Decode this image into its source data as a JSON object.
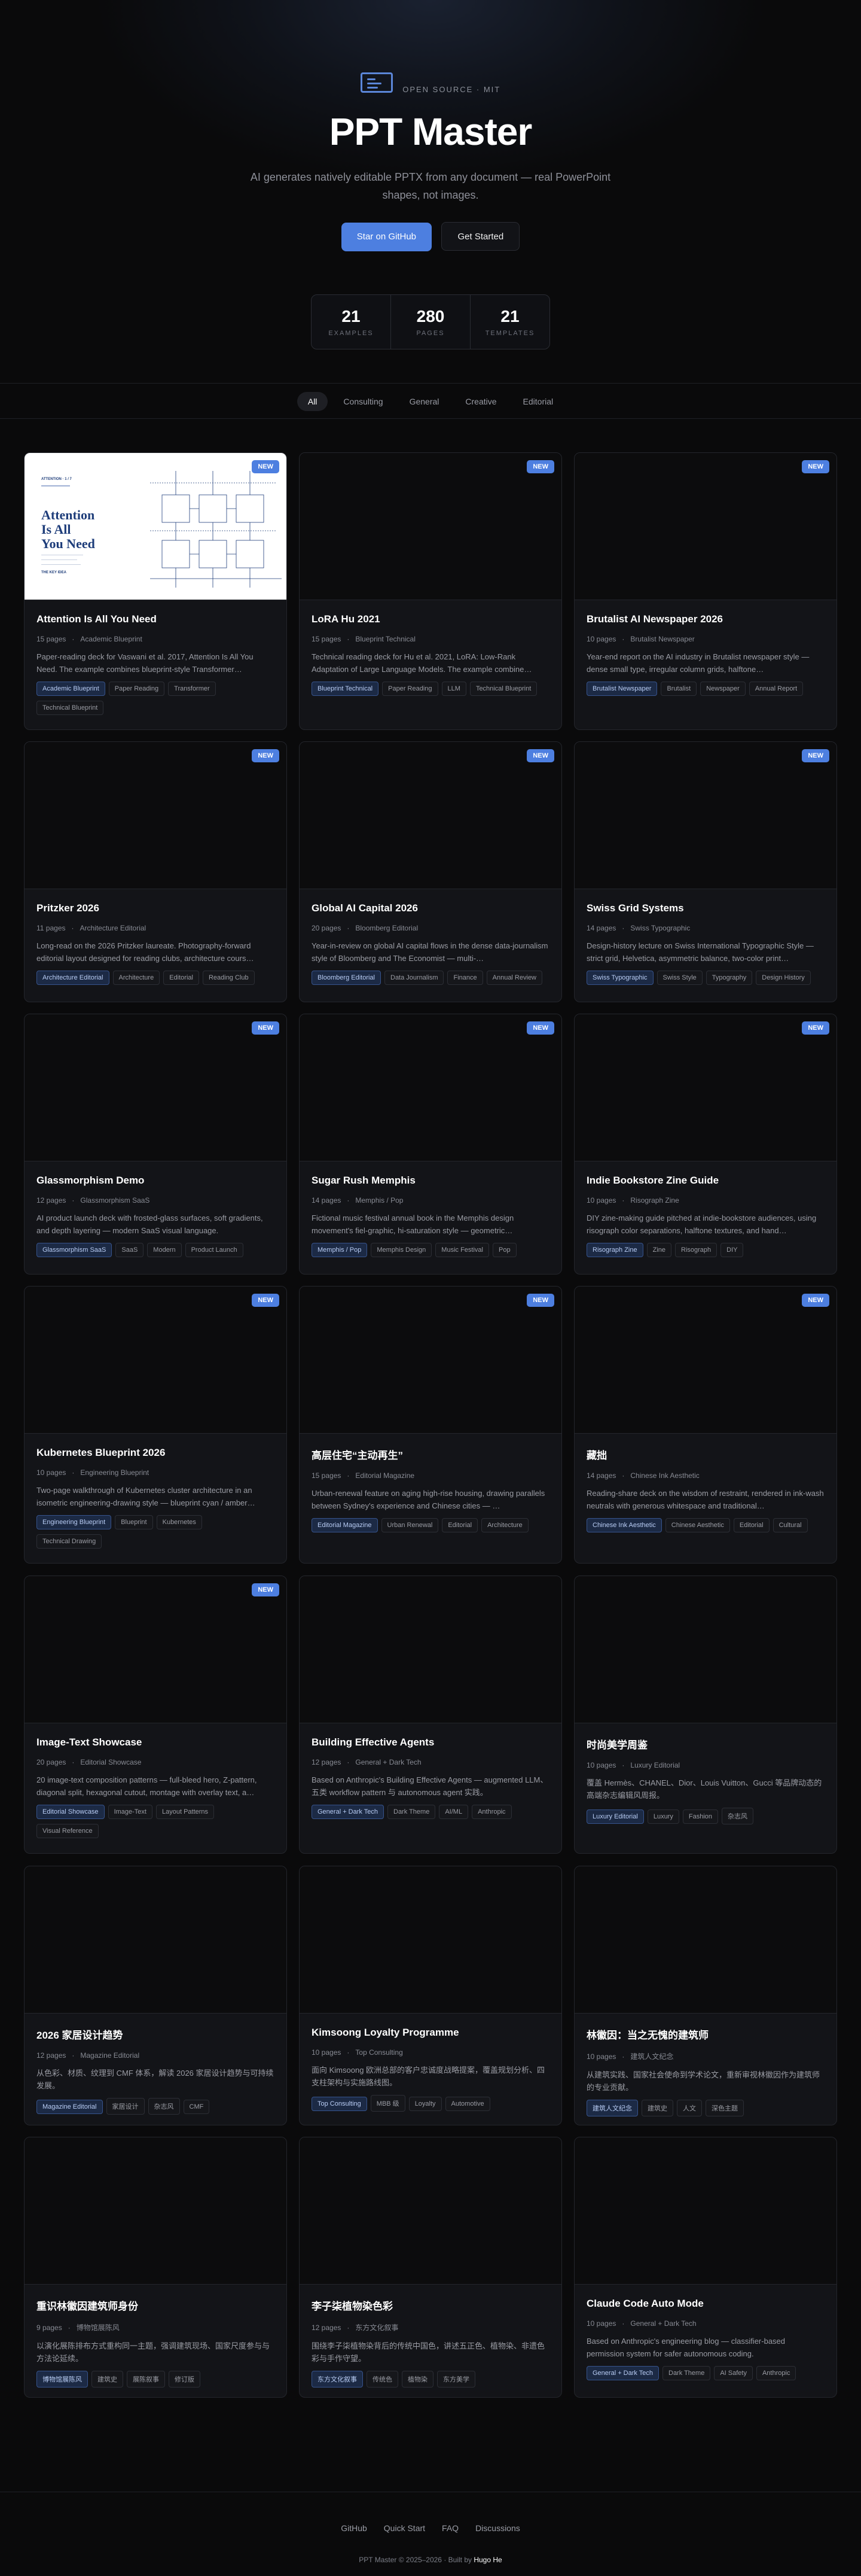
{
  "hero": {
    "tagline": "OPEN SOURCE · MIT",
    "title": "PPT Master",
    "subtitle": "AI generates natively editable PPTX from any document — real PowerPoint shapes, not images.",
    "primary_button": "Star on GitHub",
    "secondary_button": "Get Started",
    "stats": [
      {
        "num": "21",
        "label": "EXAMPLES"
      },
      {
        "num": "280",
        "label": "PAGES"
      },
      {
        "num": "21",
        "label": "TEMPLATES"
      }
    ]
  },
  "filters": [
    "All",
    "Consulting",
    "General",
    "Creative",
    "Editorial"
  ],
  "active_filter": "All",
  "badge_new": "NEW",
  "thumb_paper": {
    "header": "ATTENTION · 1 / 7",
    "title": "Attention\nIs All\nYou Need",
    "caption": "THE KEY IDEA"
  },
  "cards": [
    {
      "title": "Attention Is All You Need",
      "pages": "15 pages",
      "style": "Academic Blueprint",
      "desc": "Paper-reading deck for Vaswani et al. 2017, Attention Is All You Need. The example combines blueprint-style Transformer…",
      "tags": [
        "Academic Blueprint",
        "Paper Reading",
        "Transformer",
        "Technical Blueprint"
      ],
      "new": true,
      "paper": true
    },
    {
      "title": "LoRA Hu 2021",
      "pages": "15 pages",
      "style": "Blueprint Technical",
      "desc": "Technical reading deck for Hu et al. 2021, LoRA: Low-Rank Adaptation of Large Language Models. The example combine…",
      "tags": [
        "Blueprint Technical",
        "Paper Reading",
        "LLM",
        "Technical Blueprint"
      ],
      "new": true
    },
    {
      "title": "Brutalist AI Newspaper 2026",
      "pages": "10 pages",
      "style": "Brutalist Newspaper",
      "desc": "Year-end report on the AI industry in Brutalist newspaper style — dense small type, irregular column grids, halftone…",
      "tags": [
        "Brutalist Newspaper",
        "Brutalist",
        "Newspaper",
        "Annual Report"
      ],
      "new": true
    },
    {
      "title": "Pritzker 2026",
      "pages": "11 pages",
      "style": "Architecture Editorial",
      "desc": "Long-read on the 2026 Pritzker laureate. Photography-forward editorial layout designed for reading clubs, architecture cours…",
      "tags": [
        "Architecture Editorial",
        "Architecture",
        "Editorial",
        "Reading Club"
      ],
      "new": true
    },
    {
      "title": "Global AI Capital 2026",
      "pages": "20 pages",
      "style": "Bloomberg Editorial",
      "desc": "Year-in-review on global AI capital flows in the dense data-journalism style of Bloomberg and The Economist — multi-…",
      "tags": [
        "Bloomberg Editorial",
        "Data Journalism",
        "Finance",
        "Annual Review"
      ],
      "new": true
    },
    {
      "title": "Swiss Grid Systems",
      "pages": "14 pages",
      "style": "Swiss Typographic",
      "desc": "Design-history lecture on Swiss International Typographic Style — strict grid, Helvetica, asymmetric balance, two-color print…",
      "tags": [
        "Swiss Typographic",
        "Swiss Style",
        "Typography",
        "Design History"
      ],
      "new": true
    },
    {
      "title": "Glassmorphism Demo",
      "pages": "12 pages",
      "style": "Glassmorphism SaaS",
      "desc": "AI product launch deck with frosted-glass surfaces, soft gradients, and depth layering — modern SaaS visual language.",
      "tags": [
        "Glassmorphism SaaS",
        "SaaS",
        "Modern",
        "Product Launch"
      ],
      "new": true
    },
    {
      "title": "Sugar Rush Memphis",
      "pages": "14 pages",
      "style": "Memphis / Pop",
      "desc": "Fictional music festival annual book in the Memphis design movement's fiel-graphic, hi-saturation style — geometric…",
      "tags": [
        "Memphis / Pop",
        "Memphis Design",
        "Music Festival",
        "Pop"
      ],
      "new": true
    },
    {
      "title": "Indie Bookstore Zine Guide",
      "pages": "10 pages",
      "style": "Risograph Zine",
      "desc": "DIY zine-making guide pitched at indie-bookstore audiences, using risograph color separations, halftone textures, and hand…",
      "tags": [
        "Risograph Zine",
        "Zine",
        "Risograph",
        "DIY"
      ],
      "new": true
    },
    {
      "title": "Kubernetes Blueprint 2026",
      "pages": "10 pages",
      "style": "Engineering Blueprint",
      "desc": "Two-page walkthrough of Kubernetes cluster architecture in an isometric engineering-drawing style — blueprint cyan / amber…",
      "tags": [
        "Engineering Blueprint",
        "Blueprint",
        "Kubernetes",
        "Technical Drawing"
      ],
      "new": true
    },
    {
      "title": "高层住宅“主动再生”",
      "pages": "15 pages",
      "style": "Editorial Magazine",
      "desc": "Urban-renewal feature on aging high-rise housing, drawing parallels between Sydney's experience and Chinese cities — …",
      "tags": [
        "Editorial Magazine",
        "Urban Renewal",
        "Editorial",
        "Architecture"
      ],
      "new": true
    },
    {
      "title": "藏拙",
      "pages": "14 pages",
      "style": "Chinese Ink Aesthetic",
      "desc": "Reading-share deck on the wisdom of restraint, rendered in ink-wash neutrals with generous whitespace and traditional…",
      "tags": [
        "Chinese Ink Aesthetic",
        "Chinese Aesthetic",
        "Editorial",
        "Cultural"
      ],
      "new": true
    },
    {
      "title": "Image-Text Showcase",
      "pages": "20 pages",
      "style": "Editorial Showcase",
      "desc": "20 image-text composition patterns — full-bleed hero, Z-pattern, diagonal split, hexagonal cutout, montage with overlay text, a…",
      "tags": [
        "Editorial Showcase",
        "Image-Text",
        "Layout Patterns",
        "Visual Reference"
      ],
      "new": true
    },
    {
      "title": "Building Effective Agents",
      "pages": "12 pages",
      "style": "General + Dark Tech",
      "desc": "Based on Anthropic's Building Effective Agents — augmented LLM、五类 workflow pattern 与 autonomous agent 实践。",
      "tags": [
        "General + Dark Tech",
        "Dark Theme",
        "AI/ML",
        "Anthropic"
      ],
      "new": false
    },
    {
      "title": "时尚美学周鉴",
      "pages": "10 pages",
      "style": "Luxury Editorial",
      "desc": "覆盖 Hermès、CHANEL、Dior、Louis Vuitton、Gucci 等品牌动态的高端杂志编辑风周报。",
      "tags": [
        "Luxury Editorial",
        "Luxury",
        "Fashion",
        "杂志风"
      ],
      "new": false
    },
    {
      "title": "2026 家居设计趋势",
      "pages": "12 pages",
      "style": "Magazine Editorial",
      "desc": "从色彩、材质、纹理到 CMF 体系，解读 2026 家居设计趋势与可持续发展。",
      "tags": [
        "Magazine Editorial",
        "家居设计",
        "杂志风",
        "CMF"
      ],
      "new": false
    },
    {
      "title": "Kimsoong Loyalty Programme",
      "pages": "10 pages",
      "style": "Top Consulting",
      "desc": "面向 Kimsoong 欧洲总部的客户忠诚度战略提案，覆盖规划分析、四支柱架构与实施路线图。",
      "tags": [
        "Top Consulting",
        "MBB 级",
        "Loyalty",
        "Automotive"
      ],
      "new": false
    },
    {
      "title": "林徽因：当之无愧的建筑师",
      "pages": "10 pages",
      "style": "建筑人文纪念",
      "desc": "从建筑实践、国家社会使命到学术论文，重新审视林徽因作为建筑师的专业贡献。",
      "tags": [
        "建筑人文纪念",
        "建筑史",
        "人文",
        "深色主题"
      ],
      "new": false
    },
    {
      "title": "重识林徽因建筑师身份",
      "pages": "9 pages",
      "style": "博物馆展陈风",
      "desc": "以演化展陈排布方式重构同一主题，强调建筑现场、国家尺度参与与方法论延续。",
      "tags": [
        "博物馆展陈风",
        "建筑史",
        "展陈叙事",
        "修订版"
      ],
      "new": false
    },
    {
      "title": "李子柒植物染色彩",
      "pages": "12 pages",
      "style": "东方文化叙事",
      "desc": "围绕李子柒植物染背后的传统中国色，讲述五正色、植物染、非遗色彩与手作守望。",
      "tags": [
        "东方文化叙事",
        "传统色",
        "植物染",
        "东方美学"
      ],
      "new": false
    },
    {
      "title": "Claude Code Auto Mode",
      "pages": "10 pages",
      "style": "General + Dark Tech",
      "desc": "Based on Anthropic's engineering blog — classifier-based permission system for safer autonomous coding.",
      "tags": [
        "General + Dark Tech",
        "Dark Theme",
        "AI Safety",
        "Anthropic"
      ],
      "new": false
    }
  ],
  "footer": {
    "links": [
      "GitHub",
      "Quick Start",
      "FAQ",
      "Discussions"
    ],
    "copyright": "PPT Master © 2025–2026 · Built by",
    "author": "Hugo He"
  },
  "colors": {
    "accent": "#4d7fe0",
    "background": "#0a0a0b",
    "card": "#131418"
  }
}
